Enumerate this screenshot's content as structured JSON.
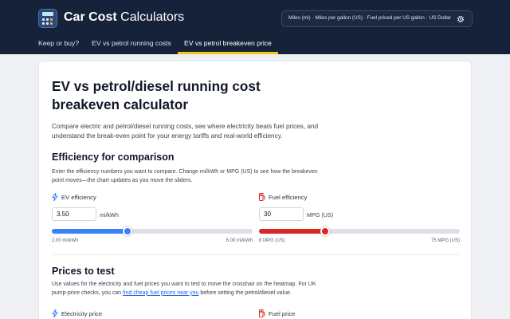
{
  "brand": {
    "bold": "Car Cost",
    "rest": " Calculators"
  },
  "settings": {
    "summary": "Miles (mi) · Miles per gallon (US) · Fuel priced per US gallon · US Dollar",
    "icon": "gear-icon"
  },
  "tabs": [
    {
      "label": "Keep or buy?",
      "active": false
    },
    {
      "label": "EV vs petrol running costs",
      "active": false
    },
    {
      "label": "EV vs petrol breakeven price",
      "active": true
    }
  ],
  "page": {
    "title": "EV vs petrol/diesel running cost breakeven calculator",
    "intro": "Compare electric and petrol/diesel running costs, see where electricity beats fuel prices, and understand the break-even point for your energy tariffs and real-world efficiency."
  },
  "efficiency": {
    "heading": "Efficiency for comparison",
    "hint": "Enter the efficiency numbers you want to compare. Change mi/kWh or MPG (US) to see how the breakeven point moves—the chart updates as you move the sliders.",
    "ev": {
      "label": "EV efficiency",
      "value": "3.50",
      "unit": "mi/kWh",
      "min_label": "2.00 mi/kWh",
      "max_label": "6.00 mi/kWh",
      "min": 2,
      "max": 6,
      "current": 3.5,
      "color": "#3b82f6",
      "icon": "lightning-icon"
    },
    "fuel": {
      "label": "Fuel efficiency",
      "value": "30",
      "unit": "MPG (US)",
      "min_label": "8 MPG (US)",
      "max_label": "75 MPG (US)",
      "min": 8,
      "max": 75,
      "current": 30,
      "color": "#dc2626",
      "icon": "fuel-pump-icon"
    }
  },
  "prices": {
    "heading": "Prices to test",
    "hint_before": "Use values for the electricity and fuel prices you want to test to move the crosshair on the heatmap. For UK pump-price checks, you can ",
    "hint_link": "find cheap fuel prices near you",
    "hint_after": " before setting the petrol/diesel value.",
    "electricity_label": "Electricity price",
    "fuel_label": "Fuel price"
  }
}
